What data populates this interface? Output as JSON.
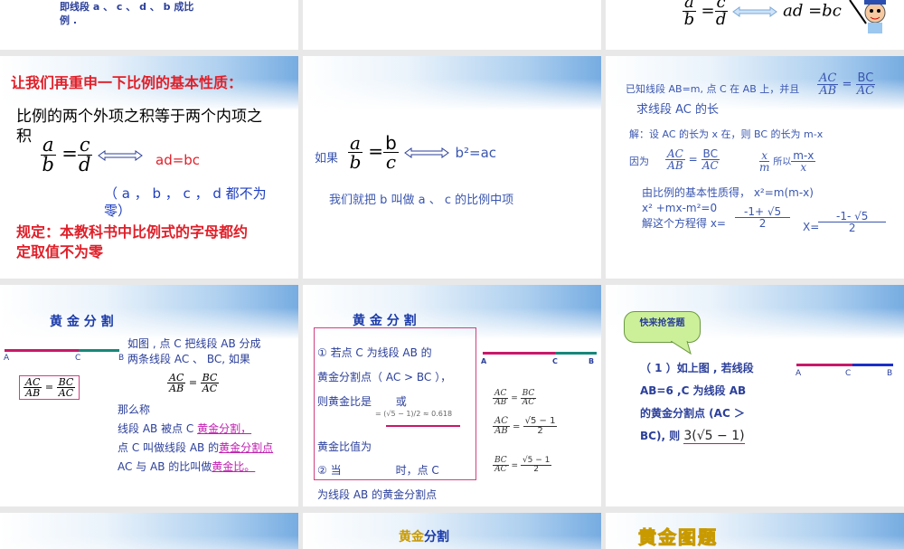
{
  "slides": {
    "s1": {
      "line1": "即线段 a 、 c 、 d 、 b 成比",
      "line2": "例 ."
    },
    "s3": {
      "formula_a": "a",
      "formula_b": "b",
      "formula_c": "c",
      "formula_d": "d",
      "eq": "ad =bc"
    },
    "s4": {
      "title": "让我们再重申一下比例的基本性质：",
      "body1": "比例的两个外项之积等于两个内项之",
      "body2": "积",
      "a": "a",
      "b": "b",
      "c": "c",
      "d": "d",
      "result": "ad=bc",
      "note1": "（ a ， b ， c ， d 都不为",
      "note2": "零）",
      "rule1": "规定：本教科书中比例式的字母都约",
      "rule2": "定取值不为零"
    },
    "s5": {
      "if": "如果",
      "a": "a",
      "b": "b",
      "b2": "b",
      "c": "c",
      "result": "b²=ac",
      "desc": "我们就把 b 叫做 a 、 c 的比例中项"
    },
    "s6": {
      "q1": "已知线段 AB=m, 点 C 在 AB 上，并且",
      "q2": "求线段 AC 的长",
      "ac": "AC",
      "ab": "AB",
      "bc": "BC",
      "sol": "解：设 AC 的长为 x 在，则 BC 的长为 m-x",
      "because": "因为",
      "x": "x",
      "m": "m",
      "so": "所以",
      "mx": "m-x",
      "l1": "由比例的基本性质得， x²=m(m-x)",
      "l2": "x² +mx-m²=0",
      "l3": "解这个方程得 x=",
      "r1n": "-1+ √5",
      "two": "2",
      "X": "X=",
      "r2n": "-1- √5"
    },
    "s7": {
      "title": "黄 金 分 割",
      "A": "A",
      "C": "C",
      "B": "B",
      "t1": "如图 , 点 C 把线段 AB 分成",
      "t2": "两条线段 AC 、 BC, 如果",
      "AC": "AC",
      "AB": "AB",
      "BC": "BC",
      "t3": "那么称",
      "t4a": "线段 AB 被点 C ",
      "t4b": "黄金分割，",
      "t5a": "点 C 叫做线段 AB 的",
      "t5b": "黄金分割点",
      "t6a": "AC 与 AB 的比叫做",
      "t6b": "黄金比。"
    },
    "s8": {
      "title": "黄 金 分 割",
      "p1": "① 若点 C 为线段 AB 的",
      "p2": "黄金分割点（ AC > BC ），",
      "p3": "则黄金比是",
      "or": "或",
      "approx": "= (√5 − 1)/2 ≈ 0.618",
      "p4": "黄金比值为",
      "p5a": "② 当",
      "p5b": "时，点 C",
      "p6": "为线段 AB 的黄金分割点",
      "A": "A",
      "C": "C",
      "B": "B",
      "AC": "AC",
      "AB": "AB",
      "BC": "BC",
      "root": "√5 − 1",
      "two": "2"
    },
    "s9": {
      "bubble": "快来抢答题",
      "q1": "（ 1 ）如上图 , 若线段",
      "q2": "AB=6 ,C 为线段 AB",
      "q3": "的黄金分割点 (AC ＞",
      "q4": "BC), 则",
      "ans": "3(√5 − 1)",
      "A": "A",
      "C": "C",
      "B": "B"
    },
    "s11": {
      "title_a": "黄金",
      "title_b": "分割"
    },
    "s12": {
      "title": "黄金图题"
    }
  },
  "colors": {
    "red": "#e0202a",
    "blue": "#2b3f9a",
    "magenta": "#c8186a",
    "teal": "#17877a"
  }
}
